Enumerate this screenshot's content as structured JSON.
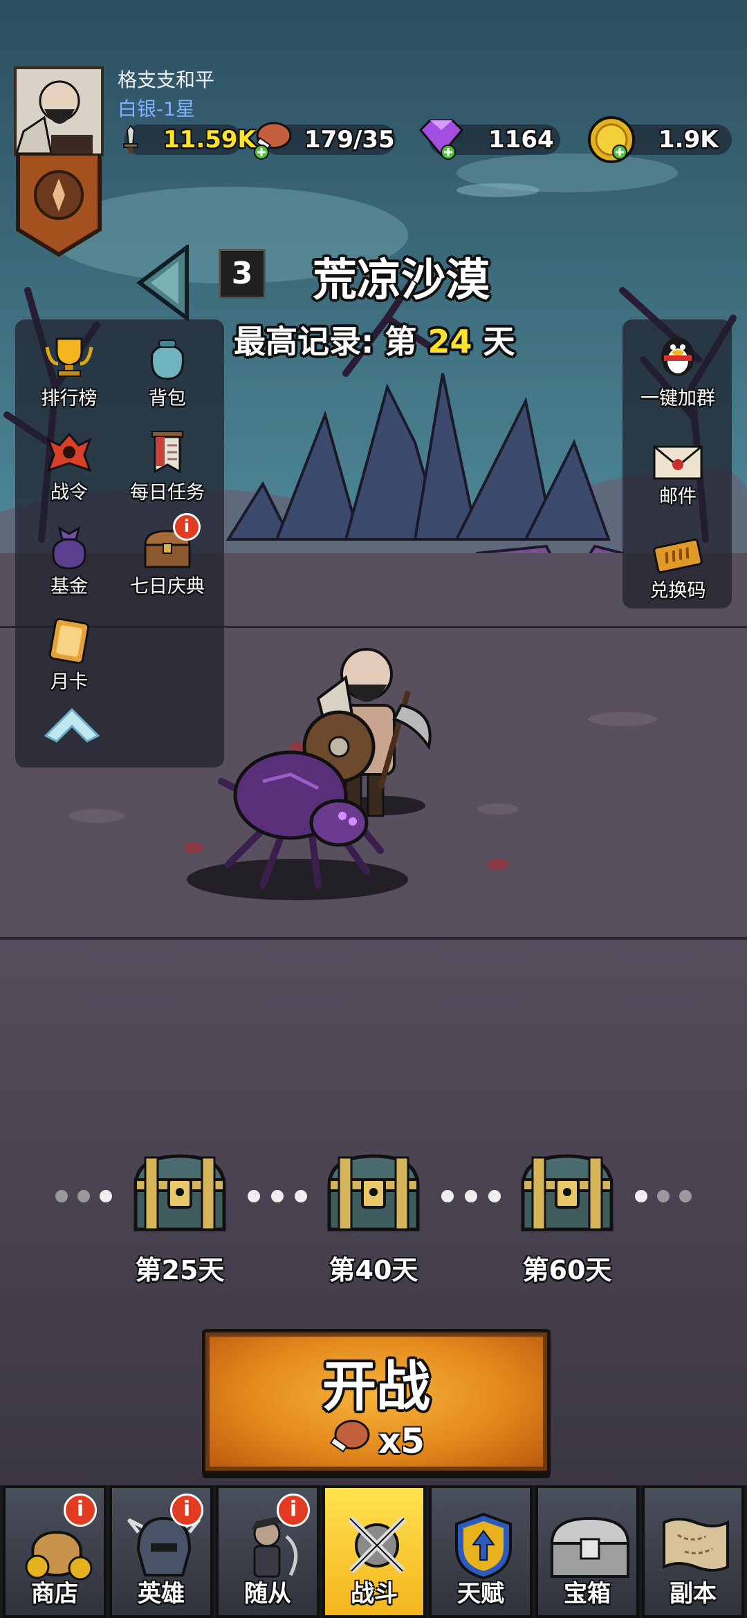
{
  "player": {
    "name": "格支支和平",
    "rank": "白银-1星"
  },
  "resources": [
    {
      "icon": "sword-power-icon",
      "value": "11.59K"
    },
    {
      "icon": "meat-stamina-icon",
      "value": "179/35"
    },
    {
      "icon": "purple-gem-icon",
      "value": "1164"
    },
    {
      "icon": "gold-coin-icon",
      "value": "1.9K"
    }
  ],
  "level": {
    "number": "3",
    "name": "荒凉沙漠",
    "record_prefix": "最高记录: 第 ",
    "record_day": "24",
    "record_suffix": " 天"
  },
  "left_menu": [
    {
      "label": "排行榜",
      "icon": "trophy-icon"
    },
    {
      "label": "背包",
      "icon": "bag-icon"
    },
    {
      "label": "战令",
      "icon": "battle-pass-icon"
    },
    {
      "label": "每日任务",
      "icon": "scroll-flag-icon"
    },
    {
      "label": "基金",
      "icon": "money-bag-icon"
    },
    {
      "label": "七日庆典",
      "icon": "treasure-chest-icon",
      "badge": "i"
    },
    {
      "label": "月卡",
      "icon": "month-card-icon"
    }
  ],
  "right_menu": [
    {
      "label": "一键加群",
      "icon": "penguin-icon"
    },
    {
      "label": "邮件",
      "icon": "mail-icon"
    },
    {
      "label": "兑换码",
      "icon": "ticket-icon"
    }
  ],
  "milestones": [
    {
      "label": "第25天"
    },
    {
      "label": "第40天"
    },
    {
      "label": "第60天"
    }
  ],
  "start": {
    "label": "开战",
    "cost": "x5"
  },
  "nav": [
    {
      "label": "商店",
      "icon": "shop-icon",
      "badge": "i"
    },
    {
      "label": "英雄",
      "icon": "hero-helmet-icon",
      "badge": "i"
    },
    {
      "label": "随从",
      "icon": "follower-icon",
      "badge": "i"
    },
    {
      "label": "战斗",
      "icon": "crossed-swords-icon",
      "active": true
    },
    {
      "label": "天赋",
      "icon": "talent-shield-icon"
    },
    {
      "label": "宝箱",
      "icon": "silver-chest-icon"
    },
    {
      "label": "副本",
      "icon": "map-scroll-icon"
    }
  ],
  "colors": {
    "accent_yellow": "#ffe22a",
    "rank_blue": "#7fb2ff",
    "active_tab": "#f3b51d",
    "badge_red": "#e23b22"
  }
}
